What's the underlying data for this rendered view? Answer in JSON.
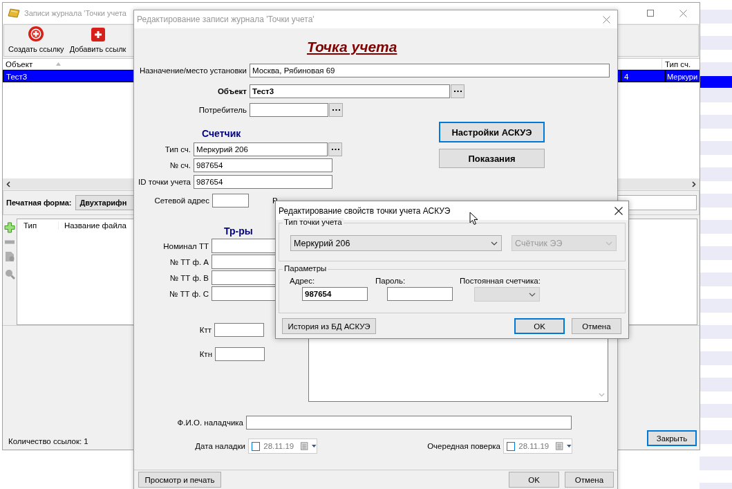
{
  "journal_window": {
    "title": "Записи журнала 'Точки учета",
    "active": false,
    "toolbar": [
      {
        "label": "Создать ссылку",
        "kind": "round"
      },
      {
        "label": "Добавить ссылк",
        "kind": "square"
      }
    ],
    "table": {
      "columns": [
        {
          "label": "Объект",
          "sorted": true
        },
        {
          "sorted": false
        },
        {
          "label": "Тип сч.",
          "sorted": false
        }
      ],
      "rows": [
        {
          "cells": [
            "Тест3",
            "4",
            "Меркури"
          ],
          "selected": true
        }
      ]
    },
    "print_form": {
      "label": "Печатная форма:",
      "value": "Двухтарифн"
    },
    "files": {
      "columns": [
        "Тип",
        "Название файла"
      ]
    },
    "count": "Количество ссылок: 1",
    "close_button": "Закрыть"
  },
  "edit_dialog": {
    "title": "Редактирование записи журнала 'Точки учета'",
    "active": false,
    "heading": "Точка учета",
    "fields": [
      {
        "label": "Назначение/место установки",
        "value": "Москва, Рябиновая 69",
        "bold": false,
        "browse": false
      },
      {
        "label": "Объект",
        "value": "Тест3",
        "bold": true,
        "browse": true
      },
      {
        "label": "Потребитель",
        "bold": false,
        "browse": true
      }
    ],
    "counter": {
      "heading": "Счетчик",
      "fields": [
        {
          "label": "Тип сч.",
          "value": "Меркурий 206",
          "browse": true
        },
        {
          "label": "№ сч.",
          "value": "987654",
          "browse": false
        },
        {
          "label": "ID точки учета",
          "value": "987654",
          "browse": false
        }
      ],
      "network_label": "Сетевой адрес",
      "cut_label": "Р"
    },
    "side_buttons": [
      {
        "label": "Настройки АСКУЭ",
        "focused": true
      },
      {
        "label": "Показания",
        "focused": false
      }
    ],
    "transformers": {
      "heading": "Тр-ры",
      "fields": [
        "Номинал ТТ",
        "№ ТТ ф. А",
        "№ ТТ ф. В",
        "№ ТТ ф. С"
      ],
      "ktt": "Ктт",
      "ktn": "Ктн"
    },
    "installer_label": "Ф.И.О. наладчика",
    "dates": [
      {
        "label": "Дата наладки",
        "value": "28.11.19",
        "checked": false
      },
      {
        "label": "Очередная поверка",
        "value": "28.11.19",
        "checked": false
      }
    ],
    "footer": {
      "preview": "Просмотр и печать",
      "ok": "OK",
      "cancel": "Отмена"
    }
  },
  "askue_dialog": {
    "title": "Редактирование свойств точки учета АСКУЭ",
    "active": true,
    "type_group": {
      "legend": "Тип точки учета",
      "combos": [
        {
          "value": "Меркурий 206",
          "disabled": false
        },
        {
          "value": "Счётчик ЭЭ",
          "disabled": true
        }
      ]
    },
    "params": {
      "legend": "Параметры",
      "address_label": "Адрес:",
      "address": "987654",
      "password_label": "Пароль:",
      "constant_label": "Постоянная счетчика:",
      "constant_disabled": true
    },
    "buttons": {
      "history": "История из БД АСКУЭ",
      "ok": {
        "label": "OK",
        "focused": true
      },
      "cancel": "Отмена"
    }
  }
}
